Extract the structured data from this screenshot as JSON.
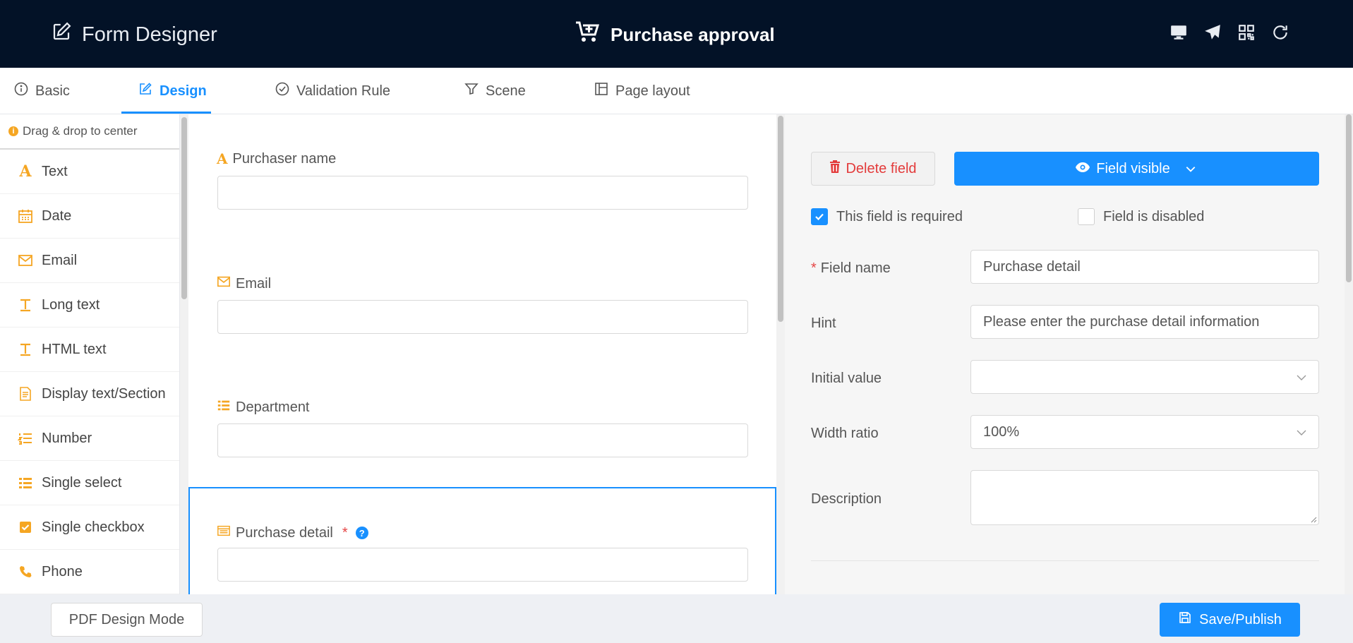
{
  "header": {
    "app_name": "Form Designer",
    "form_title": "Purchase approval",
    "actions": [
      "desktop-icon",
      "send-icon",
      "qrcode-icon",
      "refresh-icon"
    ]
  },
  "tabs": [
    {
      "label": "Basic",
      "icon": "info-circle-icon"
    },
    {
      "label": "Design",
      "icon": "edit-icon",
      "active": true
    },
    {
      "label": "Validation Rule",
      "icon": "check-circle-icon"
    },
    {
      "label": "Scene",
      "icon": "filter-icon"
    },
    {
      "label": "Page layout",
      "icon": "layout-icon"
    }
  ],
  "palette": {
    "hint": "Drag & drop to center",
    "items": [
      {
        "label": "Text",
        "icon": "text-icon"
      },
      {
        "label": "Date",
        "icon": "calendar-icon"
      },
      {
        "label": "Email",
        "icon": "mail-icon"
      },
      {
        "label": "Long text",
        "icon": "long-text-icon"
      },
      {
        "label": "HTML text",
        "icon": "html-text-icon"
      },
      {
        "label": "Display text/Section",
        "icon": "document-icon"
      },
      {
        "label": "Number",
        "icon": "ordered-list-icon"
      },
      {
        "label": "Single select",
        "icon": "list-icon"
      },
      {
        "label": "Single checkbox",
        "icon": "checkbox-icon"
      },
      {
        "label": "Phone",
        "icon": "phone-icon"
      }
    ]
  },
  "canvas": {
    "fields": [
      {
        "label": "Purchaser name",
        "icon": "text-icon"
      },
      {
        "label": "Email",
        "icon": "mail-icon"
      },
      {
        "label": "Department",
        "icon": "list-icon"
      },
      {
        "label": "Purchase detail",
        "icon": "table-icon",
        "required_mark": "*",
        "help": "?",
        "selected": true
      }
    ]
  },
  "props": {
    "delete_label": "Delete field",
    "visible_label": "Field visible",
    "required_label": "This field is required",
    "disabled_label": "Field is disabled",
    "required_checked": true,
    "disabled_checked": false,
    "field_name_star": "*",
    "field_name_label": "Field name",
    "field_name_value": "Purchase detail",
    "hint_label": "Hint",
    "hint_value": "Please enter the purchase detail information",
    "initial_label": "Initial value",
    "initial_value": "",
    "width_label": "Width ratio",
    "width_value": "100%",
    "description_label": "Description"
  },
  "footer": {
    "pdf_label": "PDF Design Mode",
    "save_label": "Save/Publish"
  },
  "colors": {
    "header_bg": "#031227",
    "accent": "#1890ff",
    "icon_orange": "#f5a623",
    "danger": "#e33b3b"
  }
}
